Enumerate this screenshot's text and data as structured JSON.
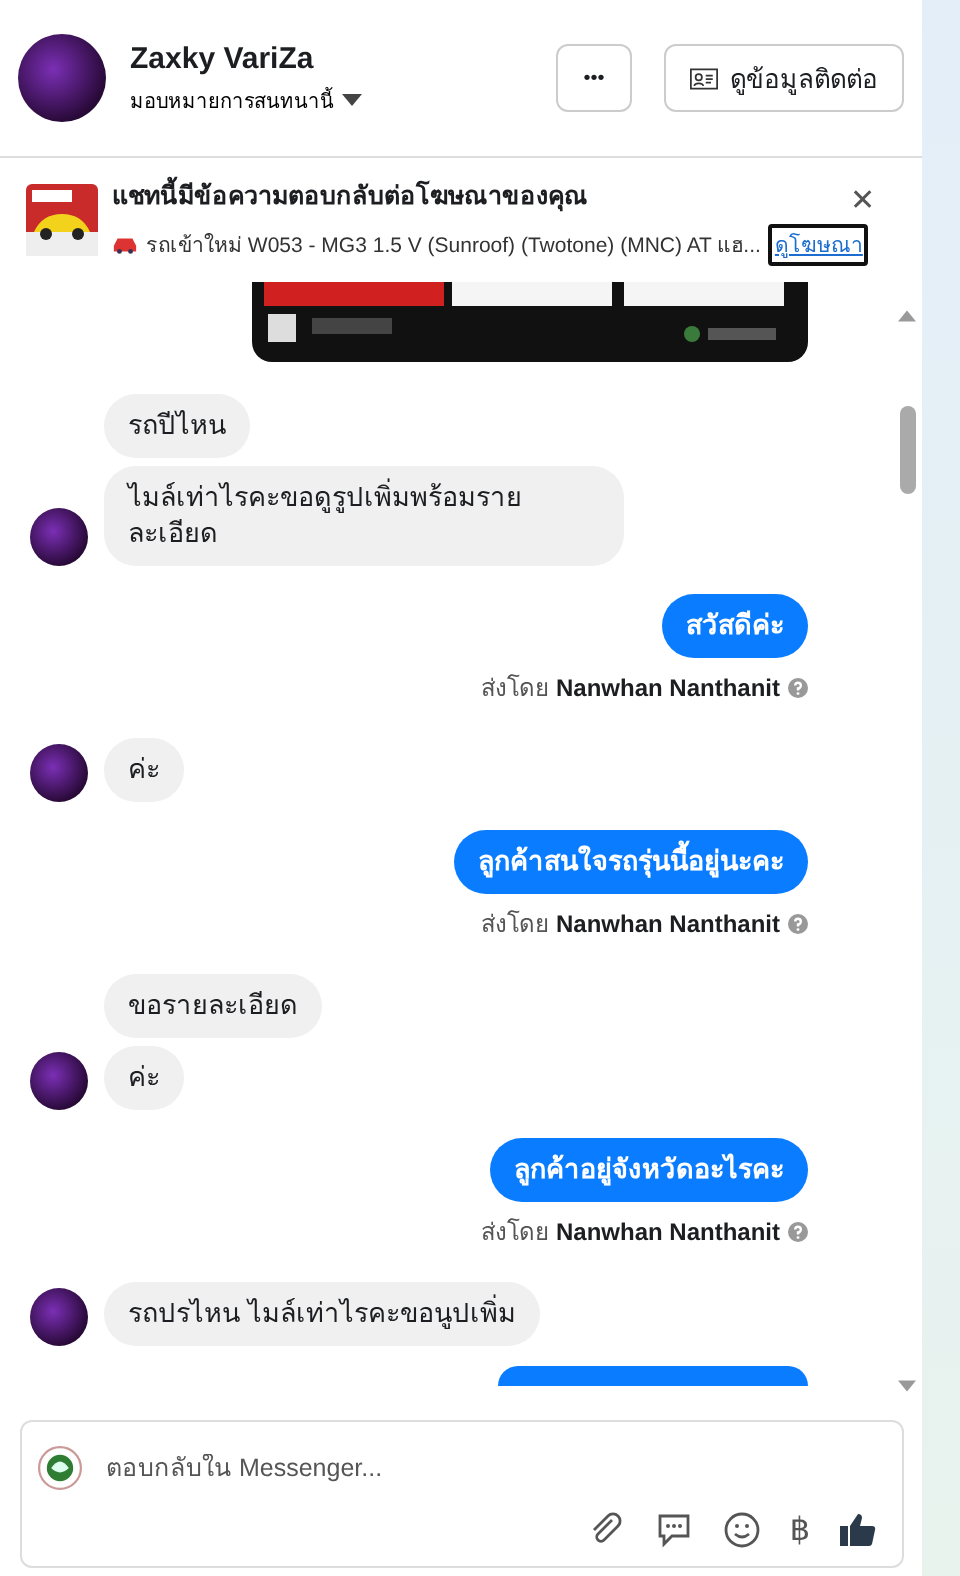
{
  "header": {
    "name": "Zaxky VariZa",
    "assign_label": "มอบหมายการสนทนานี้",
    "more_button": "•••",
    "contact_button": "ดูข้อมูลติดต่อ"
  },
  "ad_banner": {
    "title": "แชทนี้มีข้อความตอบกลับต่อโฆษณาของคุณ",
    "description": "รถเข้าใหม่ W053 - MG3 1.5 V (Sunroof) (Twotone) (MNC) AT แฮ...",
    "link": "ดูโฆษณา",
    "close": "✕"
  },
  "messages": [
    {
      "kind": "picture"
    },
    {
      "kind": "incoming",
      "text": "รถปีไหน",
      "avatar": false
    },
    {
      "kind": "incoming",
      "text": "ไมล์เท่าไรคะขอดูรูปเพิ่มพร้อมราย ละเอียด",
      "avatar": true
    },
    {
      "kind": "outgoing",
      "text": "สวัสดีค่ะ",
      "sender": "ส่งโดย **Nanwhan Nanthanit**"
    },
    {
      "kind": "incoming",
      "text": "ค่ะ",
      "avatar": true
    },
    {
      "kind": "outgoing",
      "text": "ลูกค้าสนใจรถรุ่นนี้อยู่นะคะ",
      "sender": "ส่งโดย **Nanwhan Nanthanit**"
    },
    {
      "kind": "incoming",
      "text": "ขอรายละเอียด",
      "avatar": false
    },
    {
      "kind": "incoming",
      "text": "ค่ะ",
      "avatar": true
    },
    {
      "kind": "outgoing",
      "text": "ลูกค้าอยู่จังหวัดอะไรคะ",
      "sender": "ส่งโดย **Nanwhan Nanthanit**"
    },
    {
      "kind": "incoming",
      "text": "รถปรไหน ไมล์เท่าไรคะขอนูปเพิ่ม",
      "avatar": true
    },
    {
      "kind": "outgoing_cut"
    }
  ],
  "composer": {
    "placeholder": "ตอบกลับใน Messenger...",
    "baht_icon": "฿"
  }
}
